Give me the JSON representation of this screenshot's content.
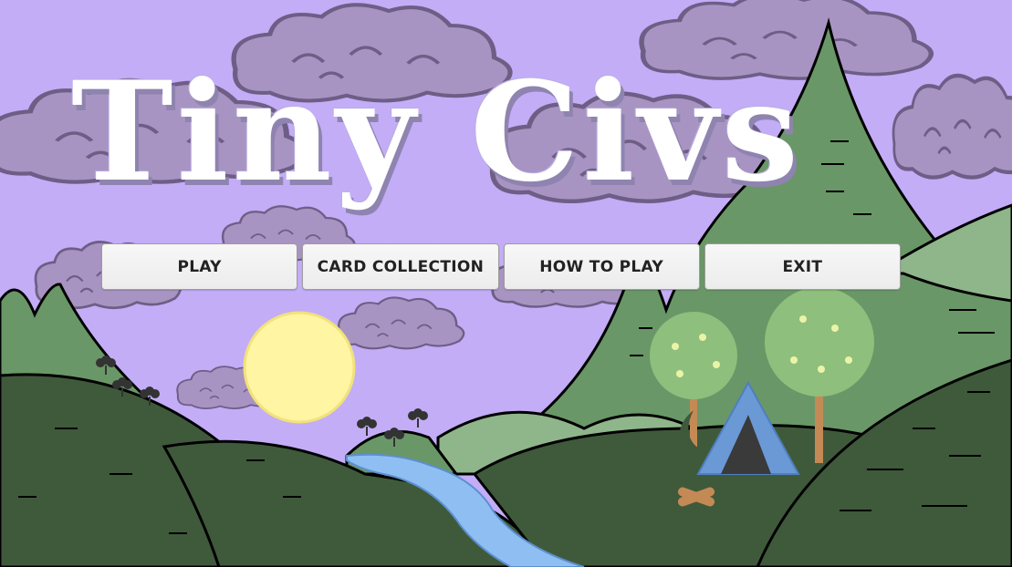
{
  "game": {
    "title": "Tiny Civs"
  },
  "menu": {
    "play_label": "PLAY",
    "collection_label": "CARD COLLECTION",
    "howto_label": "HOW TO PLAY",
    "exit_label": "EXIT"
  },
  "colors": {
    "sky": "#c3adf7",
    "cloud": "#a894c2",
    "mountain": "#6a9767",
    "hill_dark": "#3f5a3b",
    "hill_light": "#8fb58a",
    "river": "#8fbff2",
    "sun": "#fff5a3",
    "tent": "#6a99d6"
  }
}
